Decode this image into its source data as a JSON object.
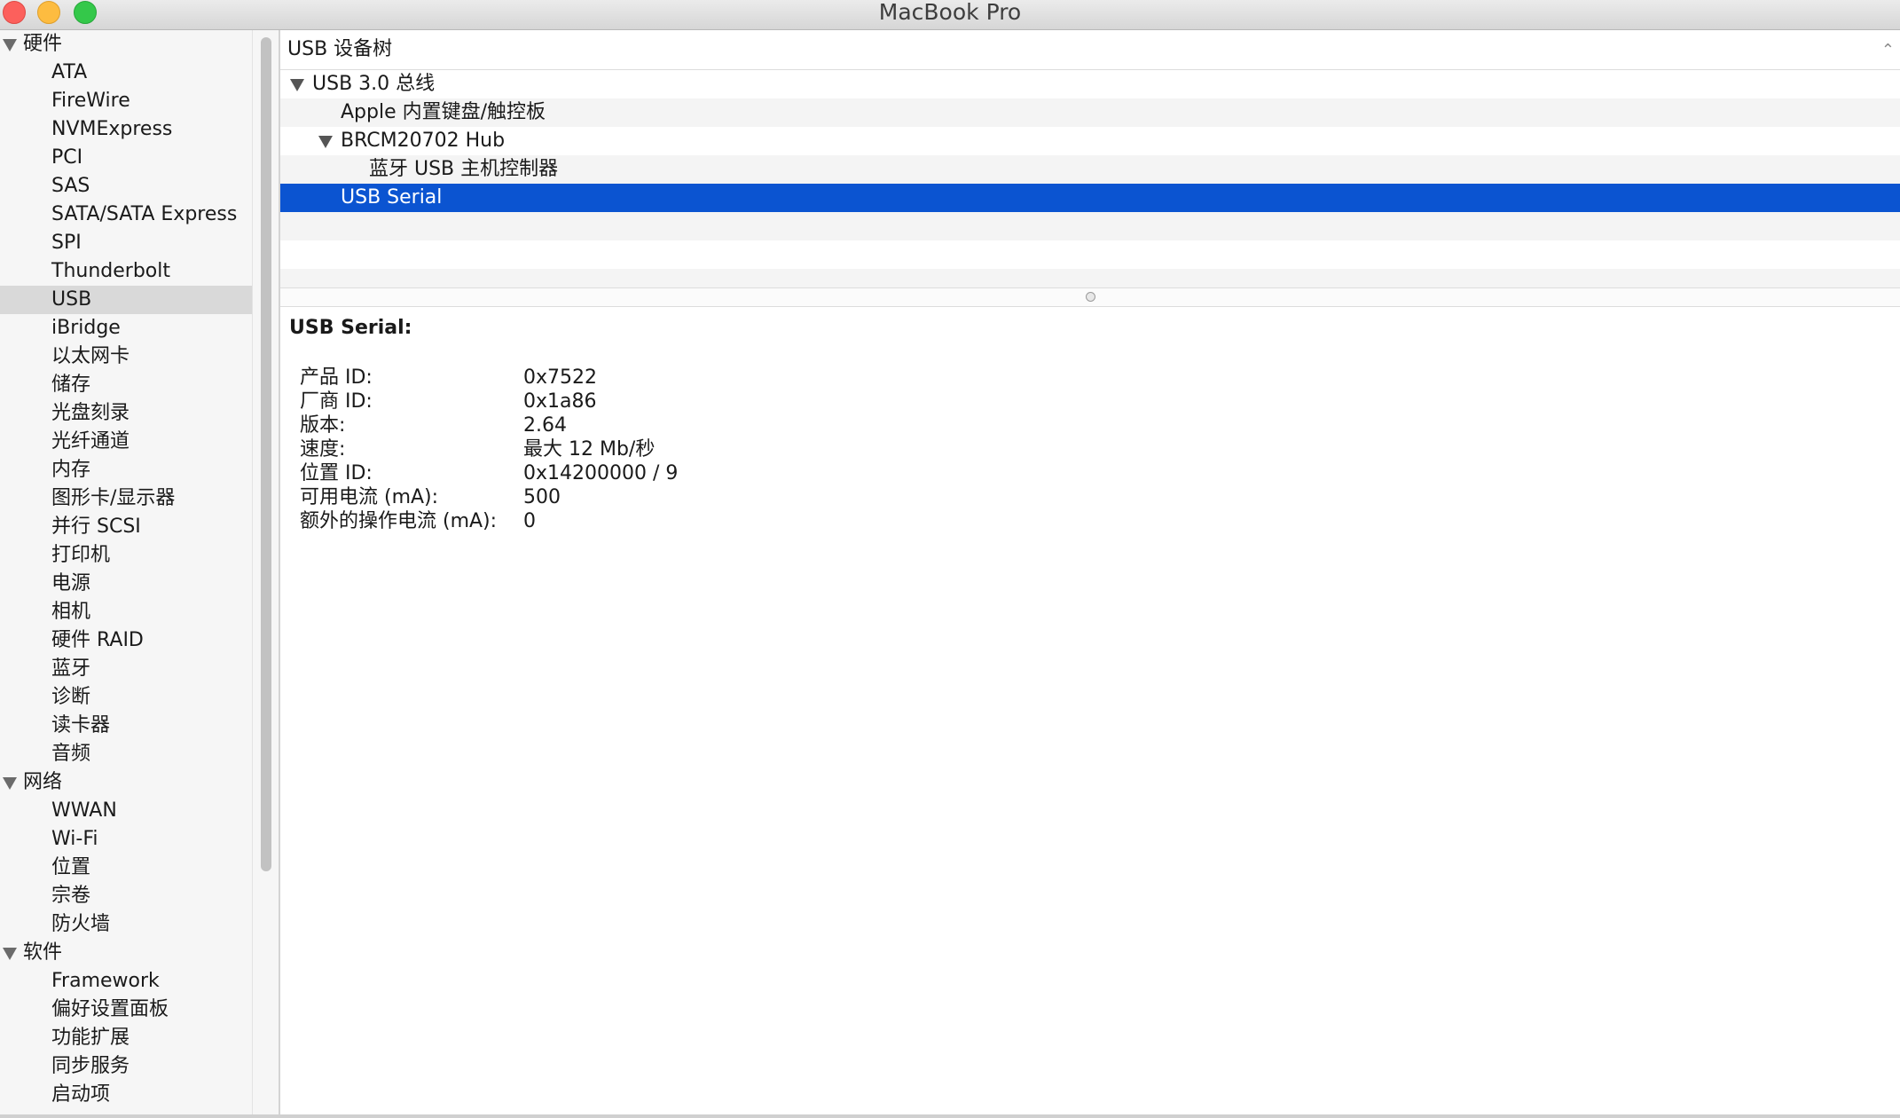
{
  "window": {
    "title": "MacBook Pro"
  },
  "sidebar": {
    "groups": [
      {
        "label": "硬件",
        "items": [
          "ATA",
          "FireWire",
          "NVMExpress",
          "PCI",
          "SAS",
          "SATA/SATA Express",
          "SPI",
          "Thunderbolt",
          "USB",
          "iBridge",
          "以太网卡",
          "储存",
          "光盘刻录",
          "光纤通道",
          "内存",
          "图形卡/显示器",
          "并行 SCSI",
          "打印机",
          "电源",
          "相机",
          "硬件 RAID",
          "蓝牙",
          "诊断",
          "读卡器",
          "音频"
        ]
      },
      {
        "label": "网络",
        "items": [
          "WWAN",
          "Wi-Fi",
          "位置",
          "宗卷",
          "防火墙"
        ]
      },
      {
        "label": "软件",
        "items": [
          "Framework",
          "偏好设置面板",
          "功能扩展",
          "同步服务",
          "启动项"
        ]
      }
    ],
    "selected_item": "USB"
  },
  "tree": {
    "header": "USB 设备树",
    "sort_icon": "chevron-up-icon",
    "rows": [
      {
        "label": "USB 3.0 总线",
        "level": 0,
        "expanded": true
      },
      {
        "label": "Apple 内置键盘/触控板",
        "level": 1,
        "expanded": false
      },
      {
        "label": "BRCM20702 Hub",
        "level": 1,
        "expanded": true
      },
      {
        "label": "蓝牙 USB 主机控制器",
        "level": 2,
        "expanded": false
      },
      {
        "label": "USB Serial",
        "level": 1,
        "expanded": false,
        "selected": true
      }
    ]
  },
  "detail": {
    "title": "USB Serial:",
    "fields": [
      {
        "key": "产品 ID:",
        "value": "0x7522"
      },
      {
        "key": "厂商 ID:",
        "value": "0x1a86"
      },
      {
        "key": "版本:",
        "value": "2.64"
      },
      {
        "key": "速度:",
        "value": "最大 12 Mb/秒"
      },
      {
        "key": "位置 ID:",
        "value": "0x14200000 / 9"
      },
      {
        "key": "可用电流 (mA):",
        "value": "500"
      },
      {
        "key": "额外的操作电流 (mA):",
        "value": "0"
      }
    ]
  },
  "colors": {
    "selection": "#0b54d1",
    "sidebar_selection": "#d9d9d9",
    "close": "#fc605c",
    "minimize": "#fdbc40",
    "maximize": "#34c84a"
  }
}
